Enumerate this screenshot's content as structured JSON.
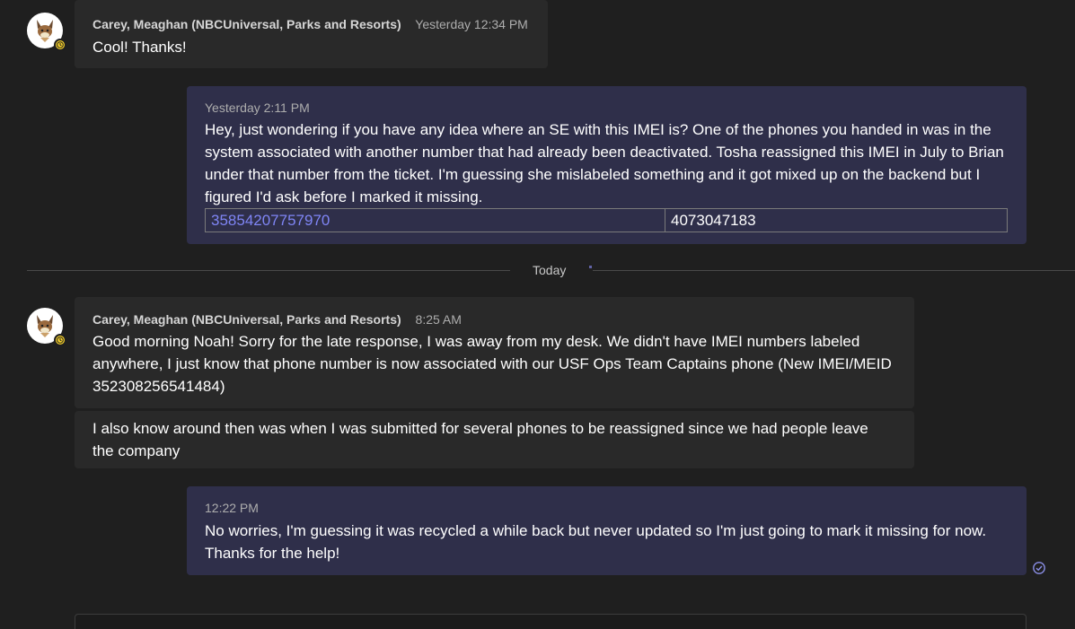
{
  "messages": [
    {
      "sender": "Carey, Meaghan (NBCUniversal, Parks and Resorts)",
      "time": "Yesterday 12:34 PM",
      "text": "Cool! Thanks!"
    },
    {
      "time": "Yesterday 2:11 PM",
      "text": "Hey, just wondering if you have any idea where an SE with this IMEI is? One of the phones you handed in was in the system associated with another number that had already been deactivated. Tosha reassigned this IMEI in July to Brian under that number from the ticket. I'm guessing she mislabeled something and it got mixed up on the backend but I figured I'd ask before I marked it missing.",
      "table": {
        "imei": "35854207757970",
        "number": "4073047183"
      }
    },
    {
      "sender": "Carey, Meaghan (NBCUniversal, Parks and Resorts)",
      "time": "8:25 AM",
      "text": "Good morning Noah! Sorry for the late response, I was away from my desk. We didn't have IMEI numbers labeled anywhere, I just know that phone number is now associated with our USF Ops Team Captains phone (New IMEI/MEID 352308256541484)",
      "followup": "I also know around then was when I was submitted for several phones to be reassigned since we had people leave the company"
    },
    {
      "time": "12:22 PM",
      "text": "No worries, I'm guessing it was recycled a while back but never updated so I'm just going to mark it missing for now. Thanks for the help!"
    }
  ],
  "divider": {
    "label": "Today"
  },
  "icons": {
    "avatar": "avatar-cartoon-icon",
    "status": "away-clock-icon",
    "read_receipt": "read-receipt-check-icon"
  },
  "colors": {
    "background": "#1f1f1f",
    "incoming_bubble": "#292929",
    "outgoing_bubble": "#2f2f4a",
    "link": "#7f85f5",
    "away_status": "#f8d22a"
  }
}
